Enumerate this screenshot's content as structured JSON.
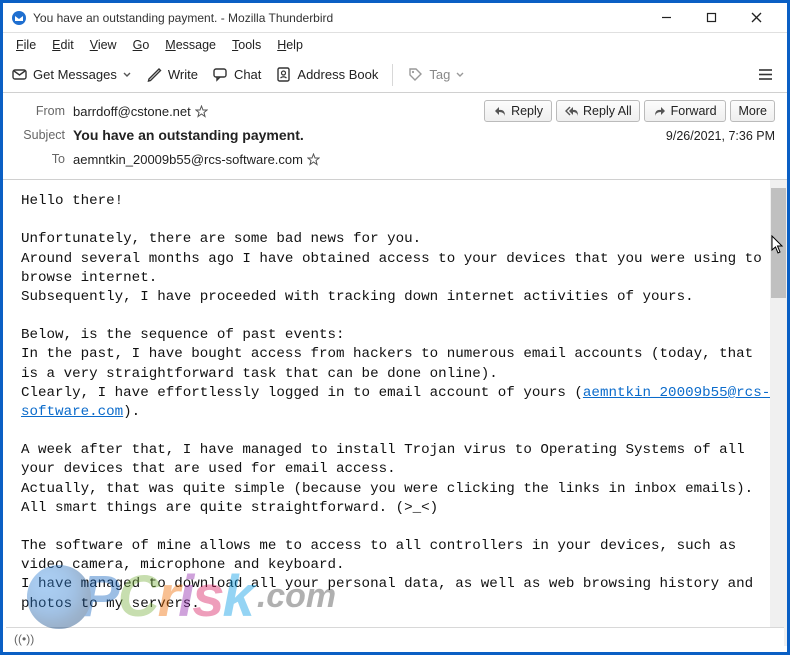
{
  "window": {
    "title": "You have an outstanding payment. - Mozilla Thunderbird"
  },
  "menu": {
    "file": "File",
    "edit": "Edit",
    "view": "View",
    "go": "Go",
    "message": "Message",
    "tools": "Tools",
    "help": "Help"
  },
  "toolbar": {
    "get_messages": "Get Messages",
    "write": "Write",
    "chat": "Chat",
    "address_book": "Address Book",
    "tag": "Tag"
  },
  "header": {
    "from_label": "From",
    "from_value": "barrdoff@cstone.net",
    "subject_label": "Subject",
    "subject_value": "You have an outstanding payment.",
    "to_label": "To",
    "to_value": "aemntkin_20009b55@rcs-software.com",
    "date": "9/26/2021, 7:36 PM"
  },
  "actions": {
    "reply": "Reply",
    "reply_all": "Reply All",
    "forward": "Forward",
    "more": "More"
  },
  "email": {
    "greeting": "Hello there!",
    "p1": "Unfortunately, there are some bad news for you.\nAround several months ago I have obtained access to your devices that you were using to browse internet.\nSubsequently, I have proceeded with tracking down internet activities of yours.",
    "p2a": "Below, is the sequence of past events:\nIn the past, I have bought access from hackers to numerous email accounts (today, that is a very straightforward task that can be done online).\nClearly, I have effortlessly logged in to email account of yours (",
    "email_link": "aemntkin_20009b55@rcs-software.com",
    "p2b": ").",
    "p3": "A week after that, I have managed to install Trojan virus to Operating Systems of all your devices that are used for email access.\nActually, that was quite simple (because you were clicking the links in inbox emails).\nAll smart things are quite straightforward. (>_<)",
    "p4": "The software of mine allows me to access to all controllers in your devices, such as video camera, microphone and keyboard.\nI have managed to download all your personal data, as well as web browsing history and photos to my servers."
  },
  "statusbar": {
    "text": "((•))"
  },
  "watermark": {
    "p": "P",
    "c": "C",
    "r": "r",
    "i": "i",
    "s": "s",
    "k": "k",
    "dotcom": ".com"
  }
}
